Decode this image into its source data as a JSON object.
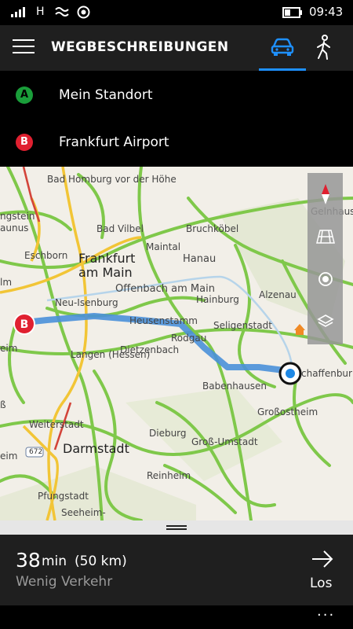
{
  "status": {
    "network": "H",
    "time": "09:43"
  },
  "header": {
    "title": "WEGBESCHREIBUNGEN",
    "menu_icon": "hamburger-icon",
    "modes": [
      {
        "name": "car-icon",
        "selected": true
      },
      {
        "name": "walk-icon",
        "selected": false
      }
    ],
    "accent": "#1e90ff"
  },
  "route": {
    "start": {
      "marker": "A",
      "label": "Mein Standort",
      "color": "#1a9e3a"
    },
    "end": {
      "marker": "B",
      "label": "Frankfurt Airport",
      "color": "#e02030"
    }
  },
  "map": {
    "places": {
      "bad_homburg": "Bad Homburg vor der Höhe",
      "gelnhausen": "Gelnhause",
      "ngstein": "ngstein",
      "aunus": "aunus",
      "bad_vilbel": "Bad Vilbel",
      "bruchkoebel": "Bruchköbel",
      "eschborn": "Eschborn",
      "maintal": "Maintal",
      "frankfurt": "Frankfurt am Main",
      "hanau": "Hanau",
      "offenbach": "Offenbach am Main",
      "neu_isenburg": "Neu-Isenburg",
      "hainburg": "Hainburg",
      "alzenau": "Alzenau",
      "heusenstamm": "Heusenstamm",
      "seligenstadt": "Seligenstadt",
      "rodgau": "Rodgau",
      "langen": "Langen (Hessen)",
      "dietzenbach": "Dietzenbach",
      "babenhausen": "Babenhausen",
      "aschaffenburg": "chaffenbur",
      "grossostheim": "Großostheim",
      "weiterstadt": "Weiterstadt",
      "dieburg": "Dieburg",
      "gross_umstadt": "Groß-Umstadt",
      "darmstadt": "Darmstadt",
      "reinheim": "Reinheim",
      "pfungstadt": "Pfungstadt",
      "seeheim": "Seeheim-",
      "left_lm": "lm",
      "left_eim": "eim",
      "left_ss": "ß",
      "road_672": "672"
    },
    "tools": [
      "compass-icon",
      "map-3d-icon",
      "location-target-icon",
      "layers-icon"
    ]
  },
  "summary": {
    "duration": "38",
    "duration_unit": "min",
    "distance": "(50 km)",
    "traffic": "Wenig Verkehr",
    "go_label": "Los"
  },
  "appbar": {
    "more": "···"
  }
}
